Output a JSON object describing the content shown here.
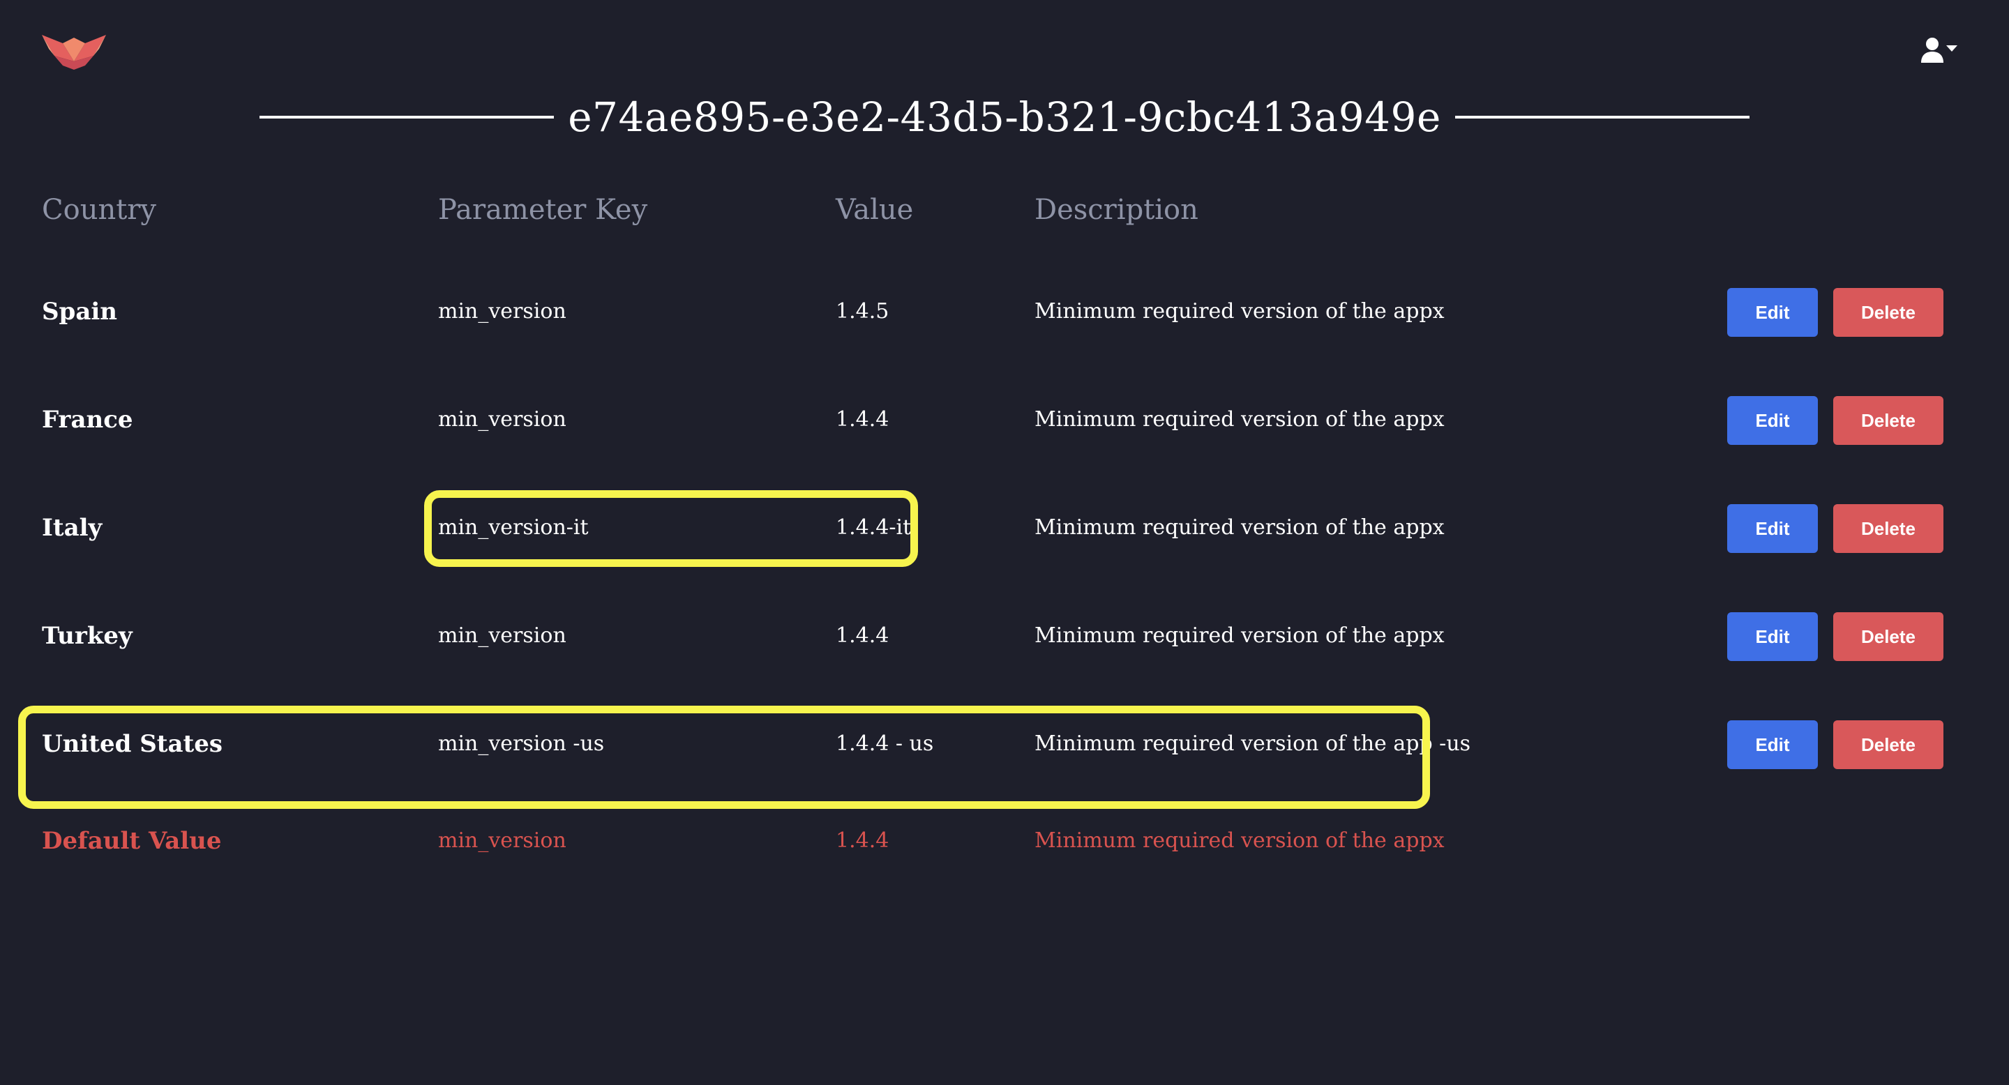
{
  "header": {
    "logo_icon": "fox-logo-icon",
    "user_menu_icon": "user-dropdown-icon",
    "title": "e74ae895-e3e2-43d5-b321-9cbc413a949e"
  },
  "table": {
    "columns": [
      "Country",
      "Parameter Key",
      "Value",
      "Description"
    ],
    "rows": [
      {
        "country": "Spain",
        "key": "min_version",
        "value": "1.4.5",
        "description": "Minimum required version of the appx",
        "edit_label": "Edit",
        "delete_label": "Delete"
      },
      {
        "country": "France",
        "key": "min_version",
        "value": "1.4.4",
        "description": "Minimum required version of the appx",
        "edit_label": "Edit",
        "delete_label": "Delete"
      },
      {
        "country": "Italy",
        "key": "min_version-it",
        "value": "1.4.4-it",
        "description": "Minimum required version of the appx",
        "edit_label": "Edit",
        "delete_label": "Delete"
      },
      {
        "country": "Turkey",
        "key": "min_version",
        "value": "1.4.4",
        "description": "Minimum required version of the appx",
        "edit_label": "Edit",
        "delete_label": "Delete"
      },
      {
        "country": "United States",
        "key": "min_version -us",
        "value": "1.4.4 - us",
        "description": "Minimum required version of the app -us",
        "edit_label": "Edit",
        "delete_label": "Delete"
      }
    ],
    "default_row": {
      "country": "Default Value",
      "key": "min_version",
      "value": "1.4.4",
      "description": "Minimum required version of the appx"
    }
  },
  "colors": {
    "background": "#1e1f2b",
    "edit_button": "#3f6fe6",
    "delete_button": "#d9585a",
    "default_text": "#d9534f",
    "highlight": "#f7f44e",
    "header_text": "#8e93a6"
  }
}
